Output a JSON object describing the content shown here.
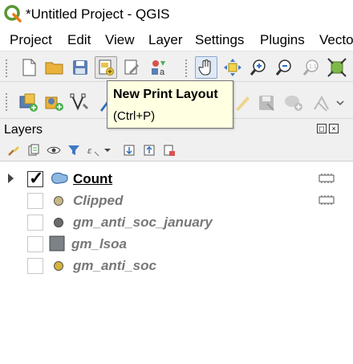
{
  "window": {
    "title": "*Untitled Project - QGIS",
    "logo_icon": "qgis-logo-icon"
  },
  "menubar": {
    "items": [
      "Project",
      "Edit",
      "View",
      "Layer",
      "Settings",
      "Plugins",
      "Vecto"
    ]
  },
  "toolbar1": {
    "icons": [
      "new-project-icon",
      "open-project-icon",
      "save-project-icon",
      "new-print-layout-icon",
      "layout-manager-icon",
      "style-manager-icon",
      "pan-hand-icon",
      "pan-to-selection-icon",
      "zoom-in-icon",
      "zoom-out-icon",
      "zoom-native-icon",
      "zoom-full-icon"
    ]
  },
  "toolbar2": {
    "icons": [
      "add-layer-icon",
      "data-source-manager-icon",
      "digitize-vertex-icon",
      "pencil-icon",
      "toggle-editing-icon",
      "save-edits-icon",
      "add-feature-icon",
      "vertex-tool-icon"
    ]
  },
  "tooltip": {
    "title": "New Print Layout",
    "shortcut": "(Ctrl+P)"
  },
  "layers_panel": {
    "title": "Layers",
    "toolbar_icons": [
      "style-brush-icon",
      "add-group-icon",
      "eye-visibility-icon",
      "filter-icon",
      "expression-filter-icon",
      "dropdown-arrow-icon",
      "expand-all-icon",
      "collapse-all-icon",
      "remove-layer-icon"
    ],
    "layers": [
      {
        "name": "Count",
        "checked": true,
        "active": true,
        "symbol": "polygon",
        "color": "#8fb8e0"
      },
      {
        "name": "Clipped",
        "checked": false,
        "active": false,
        "symbol": "point",
        "color": "#c7b885"
      },
      {
        "name": "gm_anti_soc_january",
        "checked": false,
        "active": false,
        "symbol": "point",
        "color": "#6b6b6b"
      },
      {
        "name": "gm_lsoa",
        "checked": false,
        "active": false,
        "symbol": "fill",
        "color": "#7c8287"
      },
      {
        "name": "gm_anti_soc",
        "checked": false,
        "active": false,
        "symbol": "point",
        "color": "#d6b23c"
      }
    ]
  },
  "colors": {
    "accent": "#589632",
    "tooltip_bg": "#ffffe1"
  }
}
